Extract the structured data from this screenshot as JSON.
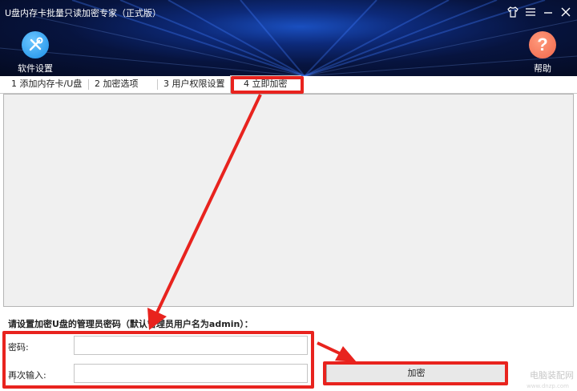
{
  "window": {
    "title": "U盘内存卡批量只读加密专家（正式版）"
  },
  "toolbar": {
    "settings_label": "软件设置",
    "help_label": "帮助",
    "help_glyph": "?"
  },
  "tabs": [
    {
      "label": "1 添加内存卡/U盘"
    },
    {
      "label": "2 加密选项"
    },
    {
      "label": "3 用户权限设置"
    },
    {
      "label": "4 立即加密",
      "active": true
    }
  ],
  "form": {
    "instruction": "请设置加密U盘的管理员密码（默认管理员用户名为admin）：",
    "password_label": "密码:",
    "password_value": "",
    "confirm_label": "再次输入:",
    "confirm_value": "",
    "encrypt_button": "加密"
  },
  "watermark": {
    "text": "电脑装配网",
    "subtext": "www.dnzp.com"
  },
  "colors": {
    "annotation_red": "#e8231e",
    "header_dark": "#07143f",
    "header_blue": "#1a4fbf",
    "panel_gray": "#f0f0f0",
    "settings_icon_blue": "#1b8fe8",
    "help_icon_orange": "#f0664a"
  },
  "icons": [
    "shirt-icon",
    "menu-icon",
    "minimize-icon",
    "close-icon",
    "wrench-screwdriver-icon",
    "question-icon",
    "arrow-icon"
  ]
}
